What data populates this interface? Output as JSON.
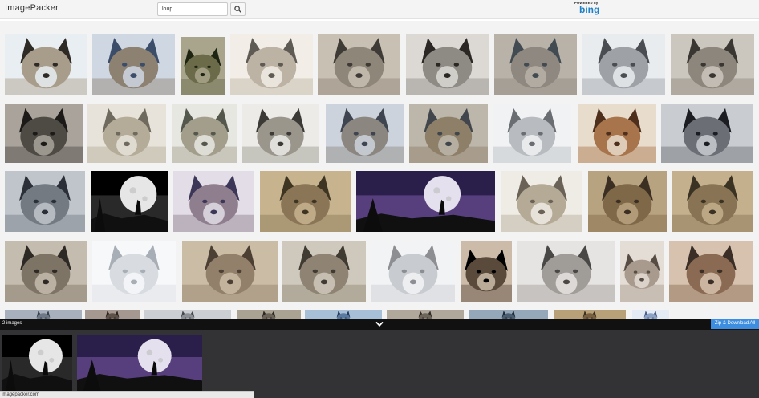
{
  "header": {
    "app_title": "ImagePacker",
    "search_value": "loup",
    "search_icon": "search-icon",
    "powered_by": "POWERED by",
    "provider": "bing"
  },
  "gallery": {
    "images": [
      {
        "subject": "wolf",
        "palette": [
          "#2e2a26",
          "#a89c8a",
          "#e9eef2"
        ]
      },
      {
        "subject": "wolf",
        "palette": [
          "#3c4d6a",
          "#8d8272",
          "#cfd7e3"
        ]
      },
      {
        "subject": "wolf",
        "palette": [
          "#1d2412",
          "#6b6b4a",
          "#a8a58c"
        ]
      },
      {
        "subject": "wolf",
        "palette": [
          "#5e5a54",
          "#bdb3a4",
          "#f2ede6"
        ]
      },
      {
        "subject": "wolf",
        "palette": [
          "#3e3a36",
          "#8e8678",
          "#c8c0b2"
        ]
      },
      {
        "subject": "wolf",
        "palette": [
          "#2a2724",
          "#8e8a84",
          "#dcd9d4"
        ]
      },
      {
        "subject": "wolf",
        "palette": [
          "#424a52",
          "#8e8880",
          "#b8b2a8"
        ]
      },
      {
        "subject": "wolf",
        "palette": [
          "#4a4e52",
          "#9ea2a6",
          "#e8ecef"
        ]
      },
      {
        "subject": "wolf",
        "palette": [
          "#3a3632",
          "#8d867c",
          "#cbc6be"
        ]
      },
      {
        "subject": "wolf",
        "palette": [
          "#1c1a18",
          "#4e4a44",
          "#a9a39b"
        ]
      },
      {
        "subject": "wolf",
        "palette": [
          "#6f6a5e",
          "#b4ab98",
          "#e8e3da"
        ]
      },
      {
        "subject": "wolf",
        "palette": [
          "#54584c",
          "#a39d8c",
          "#e7e7e2"
        ]
      },
      {
        "subject": "wolf",
        "palette": [
          "#3b3a36",
          "#9a968c",
          "#ecebe7"
        ]
      },
      {
        "subject": "wolf",
        "palette": [
          "#3f4550",
          "#8b8780",
          "#cdd3dc"
        ]
      },
      {
        "subject": "wolf",
        "palette": [
          "#41464c",
          "#8e7f68",
          "#bdb7ab"
        ]
      },
      {
        "subject": "wolf",
        "palette": [
          "#6a6e72",
          "#b8bcc0",
          "#f1f2f3"
        ]
      },
      {
        "subject": "wolf",
        "palette": [
          "#4e2f1c",
          "#a8744c",
          "#e8dccd"
        ]
      },
      {
        "subject": "wolf",
        "palette": [
          "#1b1d22",
          "#6b6e74",
          "#c9ccd1"
        ]
      },
      {
        "subject": "wolf",
        "palette": [
          "#2b3038",
          "#737a82",
          "#bfc5cb"
        ]
      },
      {
        "subject": "wolf-moon",
        "palette": [
          "#000000",
          "#4a4a4a",
          "#e6e6e6"
        ]
      },
      {
        "subject": "wolf",
        "palette": [
          "#3c3658",
          "#8f7f8e",
          "#e2dde6"
        ]
      },
      {
        "subject": "wolf",
        "palette": [
          "#3d3522",
          "#8a7556",
          "#c7b48f"
        ]
      },
      {
        "subject": "wolf-moon",
        "palette": [
          "#2a1f4a",
          "#7a5aa6",
          "#e4e0ee"
        ]
      },
      {
        "subject": "wolf",
        "palette": [
          "#6a6256",
          "#b5aa96",
          "#efece6"
        ]
      },
      {
        "subject": "wolf",
        "palette": [
          "#3a2f22",
          "#7e6848",
          "#b8a380"
        ]
      },
      {
        "subject": "wolf",
        "palette": [
          "#3a3324",
          "#887454",
          "#c4b08c"
        ]
      },
      {
        "subject": "wolf",
        "palette": [
          "#2d2a26",
          "#7e7466",
          "#c4bcae"
        ]
      },
      {
        "subject": "wolf",
        "palette": [
          "#a8aeb6",
          "#d8dce0",
          "#f7f8fa"
        ]
      },
      {
        "subject": "wolf",
        "palette": [
          "#4c4034",
          "#92806a",
          "#cbbca6"
        ]
      },
      {
        "subject": "wolf",
        "palette": [
          "#3f3a32",
          "#8f8474",
          "#cfc8bc"
        ]
      },
      {
        "subject": "wolf",
        "palette": [
          "#8c8e92",
          "#c8ccd0",
          "#f2f3f5"
        ]
      },
      {
        "subject": "wolf",
        "palette": [
          "#000000",
          "#5a4a3c",
          "#cbbba8"
        ]
      },
      {
        "subject": "wolf",
        "palette": [
          "#4a4846",
          "#a09c98",
          "#e6e4e2"
        ]
      },
      {
        "subject": "wolf",
        "palette": [
          "#564c44",
          "#a89a8c",
          "#e4ddd5"
        ]
      },
      {
        "subject": "wolf",
        "palette": [
          "#3a2e26",
          "#8a6a52",
          "#d6c2ae"
        ]
      },
      {
        "subject": "wolf",
        "palette": [
          "#36404c",
          "#6e7886",
          "#a7b0bc"
        ]
      },
      {
        "subject": "wolf",
        "palette": [
          "#2a2420",
          "#5e5248",
          "#a49890"
        ]
      },
      {
        "subject": "wolf",
        "palette": [
          "#44484c",
          "#8c9094",
          "#cbcfd3"
        ]
      },
      {
        "subject": "wolf",
        "palette": [
          "#2b2722",
          "#6c6458",
          "#aaa292"
        ]
      },
      {
        "subject": "wolf",
        "palette": [
          "#243a5a",
          "#5a7aa0",
          "#a7c0d8"
        ]
      },
      {
        "subject": "wolf",
        "palette": [
          "#2f2a26",
          "#6d645a",
          "#b1a89c"
        ]
      },
      {
        "subject": "wolf",
        "palette": [
          "#1f2a36",
          "#4a5e72",
          "#94a8ba"
        ]
      },
      {
        "subject": "wolf",
        "palette": [
          "#3a3020",
          "#786040",
          "#b8a078"
        ]
      },
      {
        "subject": "wolf",
        "palette": [
          "#4a5e86",
          "#8ea2c6",
          "#e4ebf5"
        ]
      }
    ]
  },
  "tray": {
    "count_label": "2 images",
    "toggle_icon": "chevron-down-icon",
    "download_label": "Zip & Download All",
    "items": [
      {
        "subject": "wolf-moon",
        "palette": [
          "#000000",
          "#4a4a4a",
          "#e6e6e6"
        ]
      },
      {
        "subject": "wolf-moon",
        "palette": [
          "#2a1f4a",
          "#7a5aa6",
          "#e4e0ee"
        ]
      }
    ]
  },
  "status": {
    "url": "imagepacker.com"
  }
}
